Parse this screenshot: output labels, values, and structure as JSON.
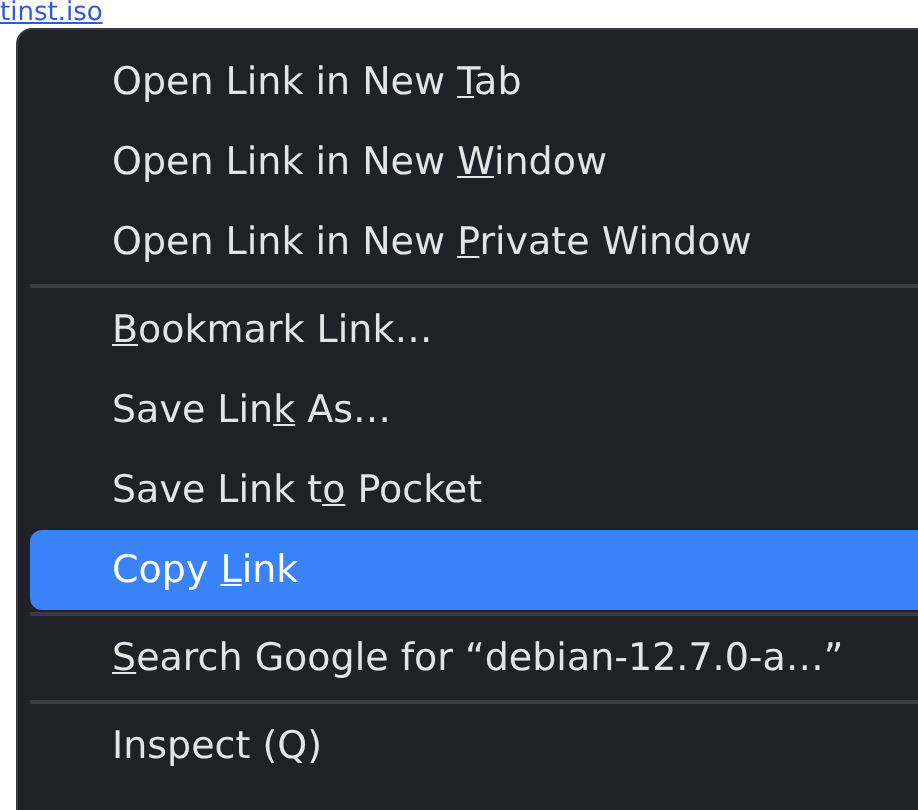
{
  "background_link": "tinst.iso",
  "menu": {
    "items": [
      {
        "kind": "item",
        "label": {
          "before": "Open Link in New ",
          "key": "T",
          "after": "ab"
        },
        "selected": false
      },
      {
        "kind": "item",
        "label": {
          "before": "Open Link in New ",
          "key": "W",
          "after": "indow"
        },
        "selected": false
      },
      {
        "kind": "item",
        "label": {
          "before": "Open Link in New ",
          "key": "P",
          "after": "rivate Window"
        },
        "selected": false
      },
      {
        "kind": "separator"
      },
      {
        "kind": "item",
        "label": {
          "key": "B",
          "after": "ookmark Link…"
        },
        "selected": false
      },
      {
        "kind": "item",
        "label": {
          "before": "Save Lin",
          "key": "k",
          "after": " As…"
        },
        "selected": false
      },
      {
        "kind": "item",
        "label": {
          "before": "Save Link t",
          "key": "o",
          "after": " Pocket"
        },
        "selected": false
      },
      {
        "kind": "item",
        "label": {
          "before": "Copy ",
          "key": "L",
          "after": "ink"
        },
        "selected": true
      },
      {
        "kind": "separator"
      },
      {
        "kind": "item",
        "label": {
          "key": "S",
          "after": "earch Google for “debian-12.7.0-a…”"
        },
        "selected": false
      },
      {
        "kind": "separator"
      },
      {
        "kind": "item",
        "label": {
          "before": "Inspect (Q)"
        },
        "selected": false
      }
    ]
  }
}
